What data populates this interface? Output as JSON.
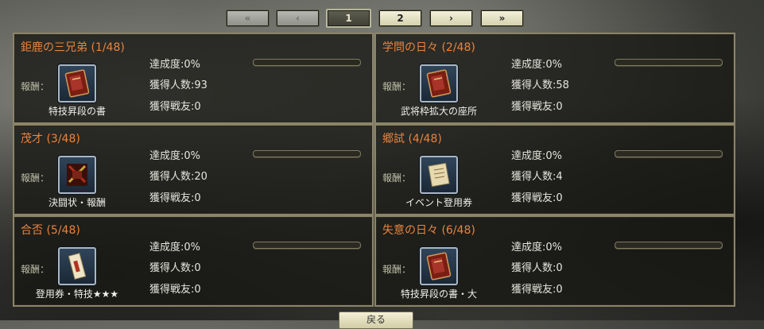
{
  "pagination": {
    "first": "«",
    "prev": "‹",
    "pages": [
      "1",
      "2"
    ],
    "current_page": 1,
    "next": "›",
    "last": "»"
  },
  "reward_label": "報酬：",
  "stat_labels": {
    "completion": "達成度:",
    "acquired": "獲得人数:",
    "friends": "獲得戦友:"
  },
  "missions": [
    {
      "title": "鉅鹿の三兄弟 (1/48)",
      "reward": "特技昇段の書",
      "icon": "red-book-icon",
      "completion": "0%",
      "completion_value": 0,
      "acquired": "93",
      "friends": "0"
    },
    {
      "title": "学問の日々 (2/48)",
      "reward": "武将枠拡大の座所",
      "icon": "red-book-icon",
      "completion": "0%",
      "completion_value": 0,
      "acquired": "58",
      "friends": "0"
    },
    {
      "title": "茂才 (3/48)",
      "reward": "決闘状・報酬",
      "icon": "duel-letter-icon",
      "completion": "0%",
      "completion_value": 0,
      "acquired": "20",
      "friends": "0"
    },
    {
      "title": "郷試 (4/48)",
      "reward": "イベント登用券",
      "icon": "scroll-icon",
      "completion": "0%",
      "completion_value": 0,
      "acquired": "4",
      "friends": "0"
    },
    {
      "title": "合否 (5/48)",
      "reward": "登用券・特技★★★",
      "icon": "ticket-icon",
      "completion": "0%",
      "completion_value": 0,
      "acquired": "0",
      "friends": "0"
    },
    {
      "title": "失意の日々 (6/48)",
      "reward": "特技昇段の書・大",
      "icon": "red-book-icon",
      "completion": "0%",
      "completion_value": 0,
      "acquired": "0",
      "friends": "0"
    }
  ],
  "bottom_button": "戻る",
  "colors": {
    "title": "#e7843f",
    "panel_border": "#8b8468"
  }
}
